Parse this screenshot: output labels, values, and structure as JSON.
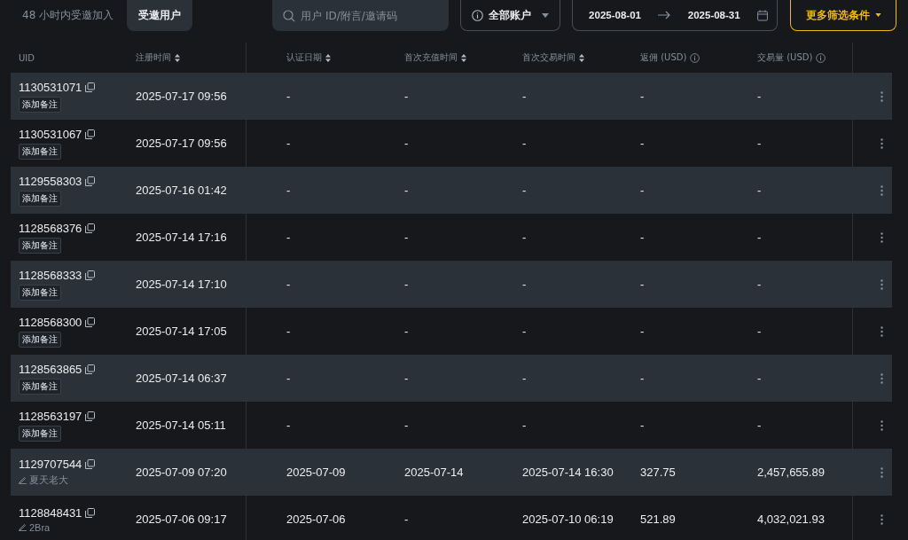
{
  "tabs": [
    {
      "label": "48 小时内受邀加入",
      "selected": false
    },
    {
      "label": "受邀用户",
      "selected": true
    }
  ],
  "search": {
    "placeholder": "用户 ID/附言/邀请码"
  },
  "account_select": {
    "value": "全部账户"
  },
  "date_range": {
    "start": "2025-08-01",
    "end": "2025-08-31"
  },
  "more_filters_button": "更多筛选条件",
  "table": {
    "columns": [
      {
        "label": "UID",
        "kind": "plain"
      },
      {
        "label": "注册时间",
        "kind": "sortable"
      },
      {
        "label": "认证日期",
        "kind": "sortable"
      },
      {
        "label": "首次充值时间",
        "kind": "sortable"
      },
      {
        "label": "首次交易时间",
        "kind": "sortable"
      },
      {
        "label": "返佣 (USD)",
        "kind": "info"
      },
      {
        "label": "交易量 (USD)",
        "kind": "info"
      }
    ],
    "rows": [
      {
        "note": {
          "kind": "add",
          "text": "添加备注"
        },
        "cells": [
          "1130531071",
          "2025-07-17 09:56",
          "-",
          "-",
          "-",
          "-",
          "-"
        ]
      },
      {
        "note": {
          "kind": "add",
          "text": "添加备注"
        },
        "cells": [
          "1130531067",
          "2025-07-17 09:56",
          "-",
          "-",
          "-",
          "-",
          "-"
        ]
      },
      {
        "note": {
          "kind": "add",
          "text": "添加备注"
        },
        "cells": [
          "1129558303",
          "2025-07-16 01:42",
          "-",
          "-",
          "-",
          "-",
          "-"
        ]
      },
      {
        "note": {
          "kind": "add",
          "text": "添加备注"
        },
        "cells": [
          "1128568376",
          "2025-07-14 17:16",
          "-",
          "-",
          "-",
          "-",
          "-"
        ]
      },
      {
        "note": {
          "kind": "add",
          "text": "添加备注"
        },
        "cells": [
          "1128568333",
          "2025-07-14 17:10",
          "-",
          "-",
          "-",
          "-",
          "-"
        ]
      },
      {
        "note": {
          "kind": "add",
          "text": "添加备注"
        },
        "cells": [
          "1128568300",
          "2025-07-14 17:05",
          "-",
          "-",
          "-",
          "-",
          "-"
        ]
      },
      {
        "note": {
          "kind": "add",
          "text": "添加备注"
        },
        "cells": [
          "1128563865",
          "2025-07-14 06:37",
          "-",
          "-",
          "-",
          "-",
          "-"
        ]
      },
      {
        "note": {
          "kind": "add",
          "text": "添加备注"
        },
        "cells": [
          "1128563197",
          "2025-07-14 05:11",
          "-",
          "-",
          "-",
          "-",
          "-"
        ]
      },
      {
        "note": {
          "kind": "remark",
          "text": "夏天老大"
        },
        "cells": [
          "1129707544",
          "2025-07-09 07:20",
          "2025-07-09",
          "2025-07-14",
          "2025-07-14 16:30",
          "327.75",
          "2,457,655.89"
        ]
      },
      {
        "note": {
          "kind": "remark",
          "text": "2Bra"
        },
        "cells": [
          "1128848431",
          "2025-07-06 09:17",
          "2025-07-06",
          "-",
          "2025-07-10 06:19",
          "521.89",
          "4,032,021.93"
        ]
      }
    ]
  }
}
